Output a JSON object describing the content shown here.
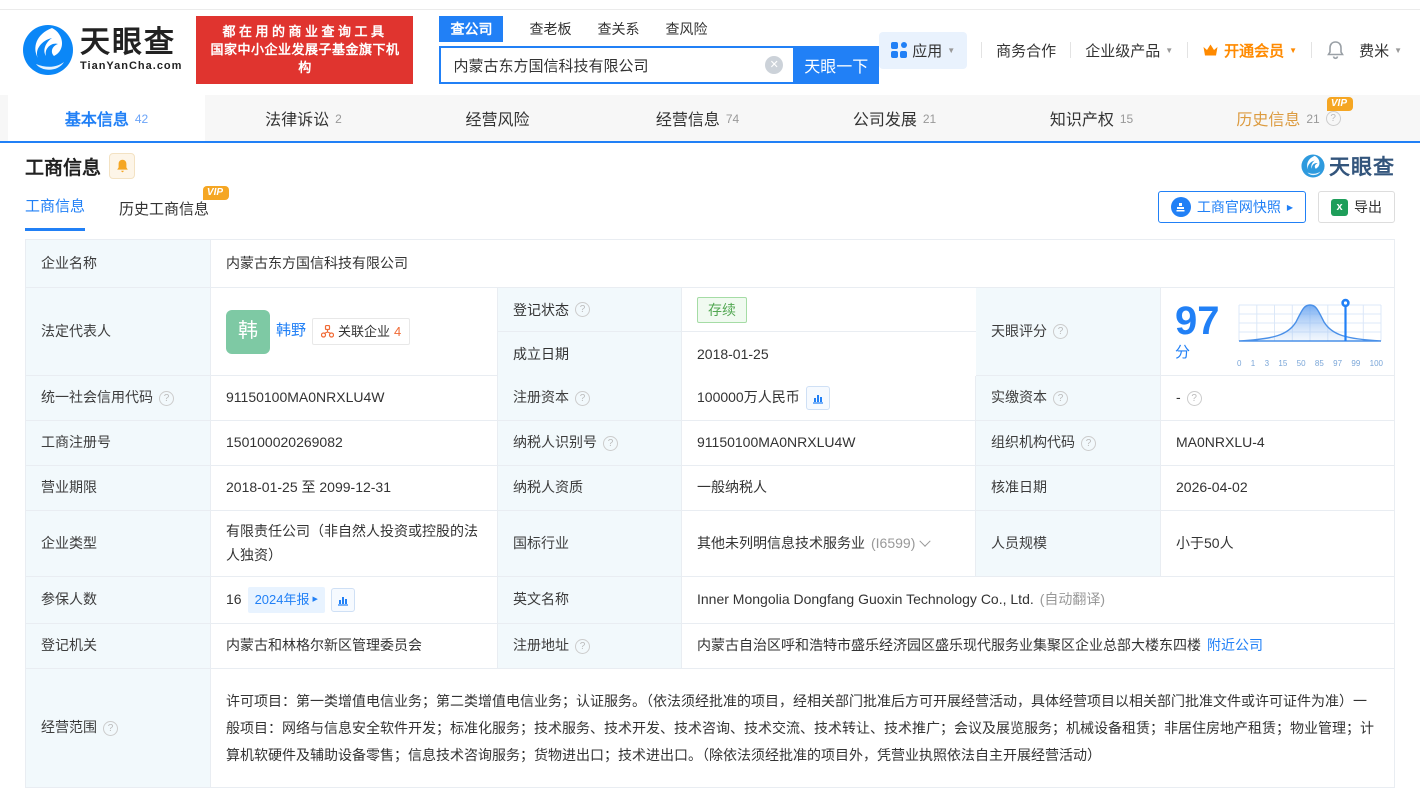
{
  "colors": {
    "accent": "#2180f6",
    "orange": "#ff8a00",
    "slogan_red": "#e0342f",
    "status_green": "#53a853",
    "avatar_green": "#7ec9a4"
  },
  "header": {
    "logo_title": "天眼查",
    "logo_domain": "TianYanCha.com",
    "slogan_line1": "都在用的商业查询工具",
    "slogan_line2": "国家中小企业发展子基金旗下机构",
    "search": {
      "tabs": [
        {
          "label": "查公司",
          "active": true
        },
        {
          "label": "查老板",
          "active": false
        },
        {
          "label": "查关系",
          "active": false
        },
        {
          "label": "查风险",
          "active": false
        }
      ],
      "value": "内蒙古东方国信科技有限公司",
      "button": "天眼一下"
    },
    "nav": {
      "apps": "应用",
      "cooperation": "商务合作",
      "enterprise": "企业级产品",
      "vip": "开通会员",
      "user": "费米"
    }
  },
  "tabs": [
    {
      "label": "基本信息",
      "count": "42"
    },
    {
      "label": "法律诉讼",
      "count": "2"
    },
    {
      "label": "经营风险",
      "count": ""
    },
    {
      "label": "经营信息",
      "count": "74"
    },
    {
      "label": "公司发展",
      "count": "21"
    },
    {
      "label": "知识产权",
      "count": "15"
    },
    {
      "label": "历史信息",
      "count": "21"
    }
  ],
  "vip_badge": "VIP",
  "section": {
    "title": "工商信息",
    "watermark": "天眼查",
    "subtabs": [
      {
        "label": "工商信息"
      },
      {
        "label": "历史工商信息"
      }
    ],
    "snapshot_button": "工商官网快照",
    "export_button": "导出"
  },
  "company": {
    "name_label": "企业名称",
    "name": "内蒙古东方国信科技有限公司",
    "legal_rep_label": "法定代表人",
    "legal_rep_avatar": "韩",
    "legal_rep_name": "韩野",
    "related_label": "关联企业",
    "related_count": "4",
    "reg_status_label": "登记状态",
    "reg_status": "存续",
    "establish_date_label": "成立日期",
    "establish_date": "2018-01-25",
    "score_label": "天眼评分",
    "score_value": "97",
    "score_unit": "分",
    "credit_code_label": "统一社会信用代码",
    "credit_code": "91150100MA0NRXLU4W",
    "reg_capital_label": "注册资本",
    "reg_capital": "100000万人民币",
    "paid_capital_label": "实缴资本",
    "paid_capital": "-",
    "reg_number_label": "工商注册号",
    "reg_number": "150100020269082",
    "taxpayer_id_label": "纳税人识别号",
    "taxpayer_id": "91150100MA0NRXLU4W",
    "org_code_label": "组织机构代码",
    "org_code": "MA0NRXLU-4",
    "business_term_label": "营业期限",
    "business_term": "2018-01-25 至 2099-12-31",
    "taxpayer_quality_label": "纳税人资质",
    "taxpayer_quality": "一般纳税人",
    "approval_date_label": "核准日期",
    "approval_date": "2026-04-02",
    "company_type_label": "企业类型",
    "company_type": "有限责任公司（非自然人投资或控股的法人独资）",
    "industry_label": "国标行业",
    "industry": "其他未列明信息技术服务业",
    "industry_code": "(I6599)",
    "staff_size_label": "人员规模",
    "staff_size": "小于50人",
    "insured_label": "参保人数",
    "insured_count": "16",
    "annual_report_badge": "2024年报",
    "english_name_label": "英文名称",
    "english_name": "Inner Mongolia Dongfang Guoxin Technology Co., Ltd.",
    "english_name_note": "(自动翻译)",
    "reg_authority_label": "登记机关",
    "reg_authority": "内蒙古和林格尔新区管理委员会",
    "reg_address_label": "注册地址",
    "reg_address": "内蒙古自治区呼和浩特市盛乐经济园区盛乐现代服务业集聚区企业总部大楼东四楼",
    "nearby_link": "附近公司",
    "business_scope_label": "经营范围",
    "business_scope": "许可项目：第一类增值电信业务；第二类增值电信业务；认证服务。（依法须经批准的项目，经相关部门批准后方可开展经营活动，具体经营项目以相关部门批准文件或许可证件为准）一般项目：网络与信息安全软件开发；标准化服务；技术服务、技术开发、技术咨询、技术交流、技术转让、技术推广；会议及展览服务；机械设备租赁；非居住房地产租赁；物业管理；计算机软硬件及辅助设备零售；信息技术咨询服务；货物进出口；技术进出口。（除依法须经批准的项目外，凭营业执照依法自主开展经营活动）"
  },
  "chart_data": {
    "type": "area",
    "title": "天眼评分分布曲线",
    "x_ticks": [
      "0",
      "1",
      "3",
      "15",
      "50",
      "85",
      "97",
      "99",
      "100"
    ],
    "marker_value": 97,
    "shape": "bell-curve",
    "peak_at": "50",
    "grid": true
  },
  "score_chart": {
    "ticks": [
      "0",
      "1",
      "3",
      "15",
      "50",
      "85",
      "97",
      "99",
      "100"
    ]
  }
}
